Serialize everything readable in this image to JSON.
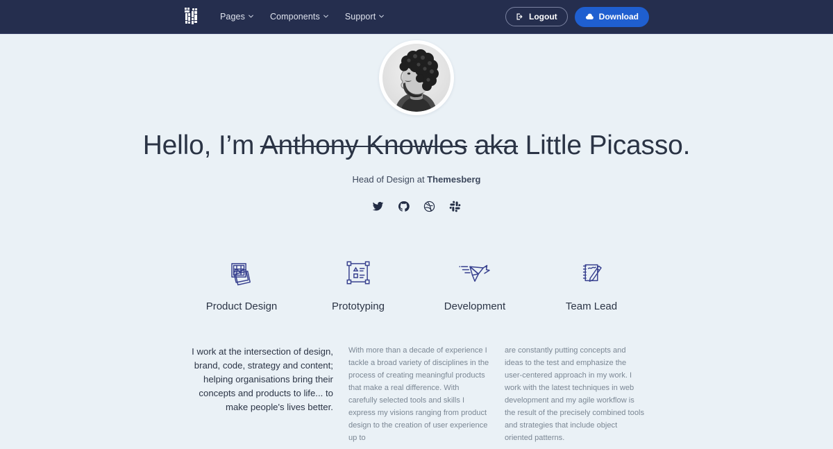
{
  "colors": {
    "navbar_bg": "#252e4e",
    "page_bg": "#eaf1f6",
    "accent_blue": "#1f5fd0",
    "icon_indigo": "#38418f",
    "heading": "#2b3445",
    "muted_text": "#7b8794"
  },
  "navbar": {
    "logo_name": "themesberg-logo",
    "links": [
      {
        "label": "Pages",
        "icon": "chevron-down-icon"
      },
      {
        "label": "Components",
        "icon": "chevron-down-icon"
      },
      {
        "label": "Support",
        "icon": "chevron-down-icon"
      }
    ],
    "logout_label": "Logout",
    "logout_icon": "sign-out-icon",
    "download_label": "Download",
    "download_icon": "cloud-download-icon"
  },
  "hero": {
    "avatar_alt": "profile-photo",
    "greeting": "Hello, I’m ",
    "struck_name": "Anthony Knowles",
    "struck_aka": "aka",
    "nickname": " Little Picasso.",
    "subtitle_prefix": "Head of Design at ",
    "subtitle_company": "Themesberg",
    "socials": [
      {
        "name": "twitter-icon",
        "label": "Twitter"
      },
      {
        "name": "github-icon",
        "label": "GitHub"
      },
      {
        "name": "dribbble-icon",
        "label": "Dribbble"
      },
      {
        "name": "slack-icon",
        "label": "Slack"
      }
    ]
  },
  "features": [
    {
      "label": "Product Design",
      "icon": "stacked-images-icon"
    },
    {
      "label": "Prototyping",
      "icon": "artboard-wireframe-icon"
    },
    {
      "label": "Development",
      "icon": "origami-bird-icon"
    },
    {
      "label": "Team Lead",
      "icon": "notepad-pencil-icon"
    }
  ],
  "content": {
    "lead": "I work at the intersection of design, brand, code, strategy and content; helping organisations bring their concepts and products to life... to make people's lives better.",
    "body_left": "With more than a decade of experience I tackle a broad variety of disciplines in the process of creating meaningful products that make a real difference. With carefully selected tools and skills I express my visions ranging from product design to the creation of user experience up to",
    "body_right": "are constantly putting concepts and ideas to the test and emphasize the user-centered approach in my work. I work with the latest techniques in web development and my agile workflow is the result of the precisely combined tools and strategies that include object oriented patterns."
  }
}
